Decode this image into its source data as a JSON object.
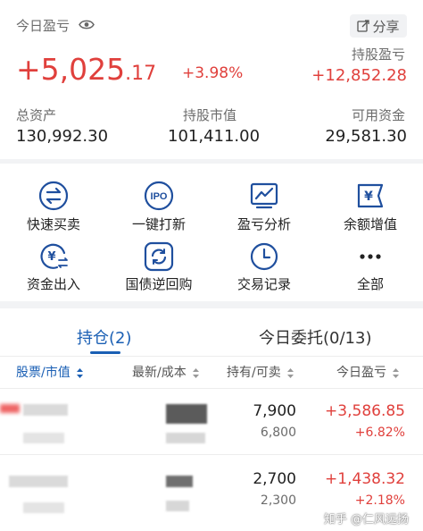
{
  "summary": {
    "today_pl_label": "今日盈亏",
    "today_pl_int": "+5,025",
    "today_pl_dec": ".17",
    "today_pl_pct": "+3.98%",
    "share_label": "分享",
    "hold_pl_label": "持股盈亏",
    "hold_pl_value": "+12,852.28",
    "total_assets_label": "总资产",
    "total_assets_value": "130,992.30",
    "market_value_label": "持股市值",
    "market_value_value": "101,411.00",
    "available_label": "可用资金",
    "available_value": "29,581.30"
  },
  "grid": {
    "items": [
      {
        "label": "快速买卖",
        "icon": "swap-arrows-icon"
      },
      {
        "label": "一键打新",
        "icon": "ipo-icon"
      },
      {
        "label": "盈亏分析",
        "icon": "chart-analysis-icon"
      },
      {
        "label": "余额增值",
        "icon": "yen-ticket-icon"
      },
      {
        "label": "资金出入",
        "icon": "yen-transfer-icon"
      },
      {
        "label": "国债逆回购",
        "icon": "refresh-bond-icon"
      },
      {
        "label": "交易记录",
        "icon": "clock-record-icon"
      },
      {
        "label": "全部",
        "icon": "more-dots-icon"
      }
    ]
  },
  "tabs": {
    "positions": "持仓(2)",
    "orders": "今日委托(0/13)"
  },
  "table": {
    "headers": [
      "股票/市值",
      "最新/成本",
      "持有/可卖",
      "今日盈亏"
    ],
    "rows": [
      {
        "hold": "7,900",
        "avail": "6,800",
        "pl": "+3,586.85",
        "pl_pct": "+6.82%"
      },
      {
        "hold": "2,700",
        "avail": "2,300",
        "pl": "+1,438.32",
        "pl_pct": "+2.18%"
      }
    ]
  },
  "watermark": "知乎 @仁风远扬",
  "colors": {
    "accent": "#1a5fb4",
    "up": "#e0403c",
    "icon": "#1f4f9e"
  }
}
